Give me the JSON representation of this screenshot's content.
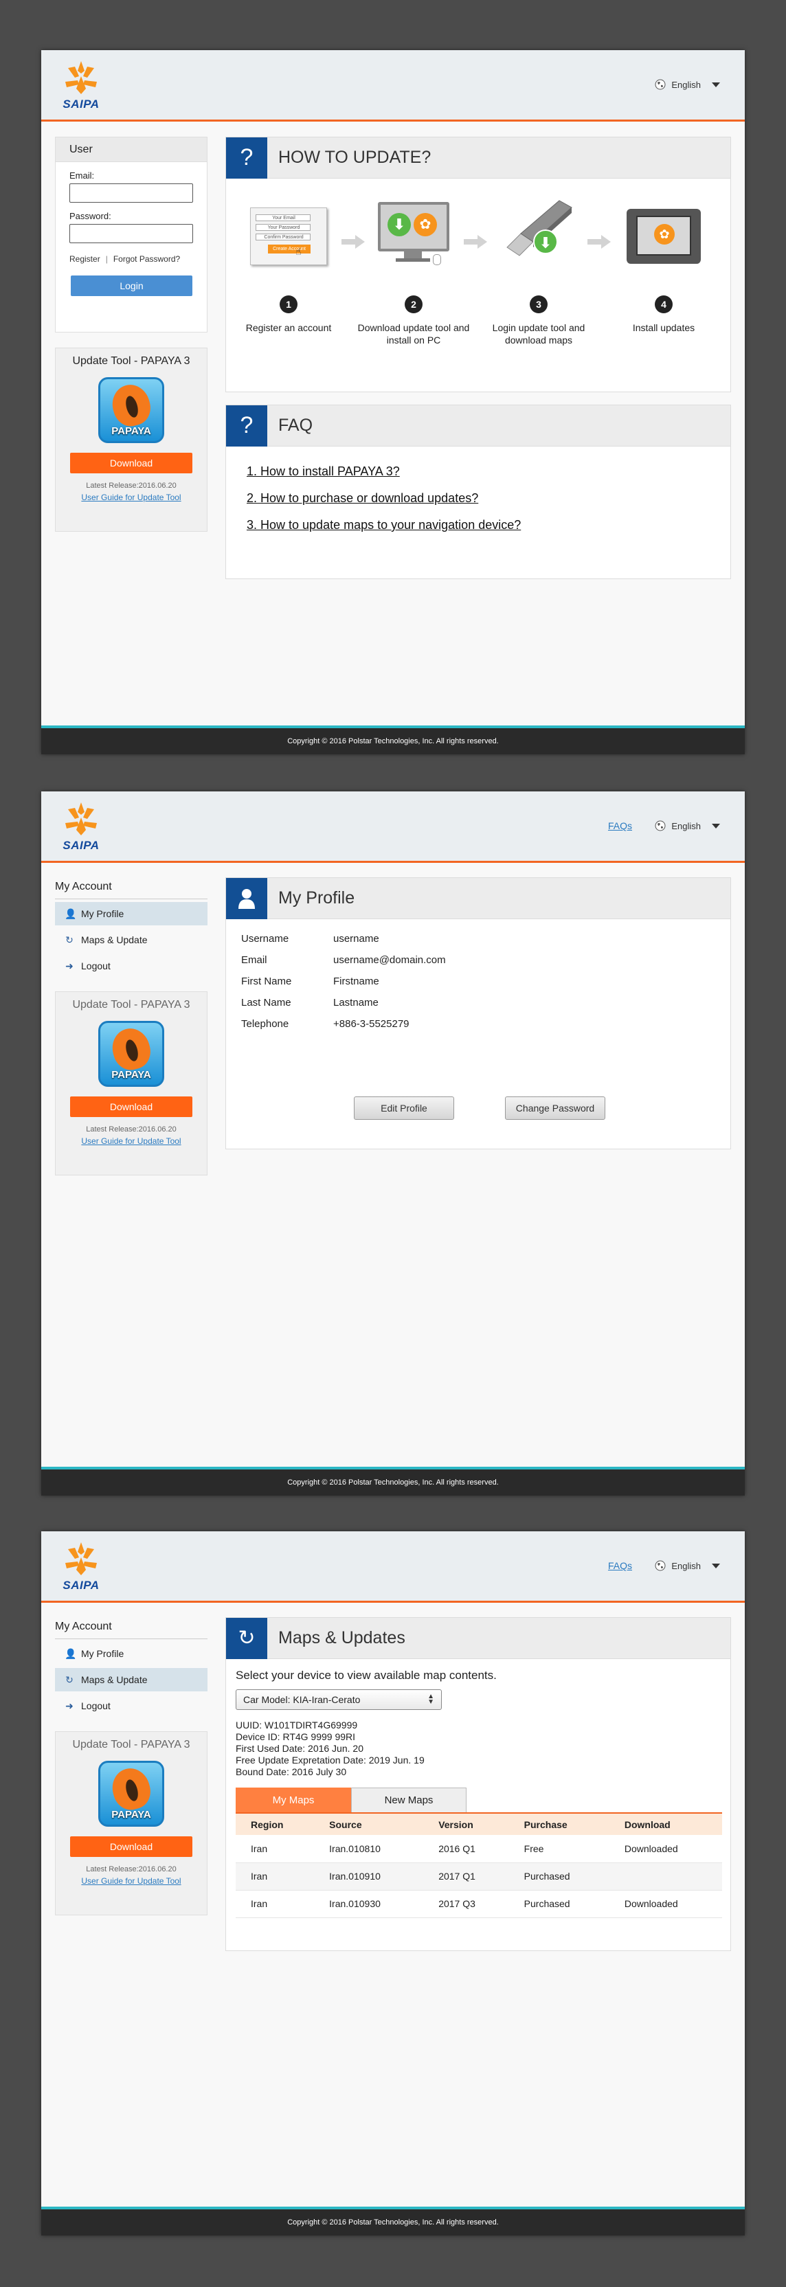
{
  "common": {
    "logo_text": "SAIPA",
    "language": "English",
    "faqs_link": "FAQs",
    "copyright": "Copyright © 2016 Polstar Technologies, Inc. All rights reserved.",
    "update_tool": {
      "title": "Update Tool - PAPAYA 3",
      "icon_label": "PAPAYA",
      "download": "Download",
      "latest_release": "Latest Release:2016.06.20",
      "guide": "User Guide for Update Tool"
    },
    "account_menu": {
      "title": "My Account",
      "items": [
        "My Profile",
        "Maps & Update",
        "Logout"
      ]
    }
  },
  "screen1": {
    "login": {
      "title": "User",
      "email_label": "Email:",
      "password_label": "Password:",
      "register": "Register",
      "forgot": "Forgot Password?",
      "login_button": "Login"
    },
    "how_to": {
      "icon": "?",
      "title": "HOW TO UPDATE?",
      "form_fields": [
        "Your Email",
        "Your Password",
        "Confirm Password"
      ],
      "form_button": "Create Account",
      "steps": [
        {
          "num": "1",
          "text": "Register an account"
        },
        {
          "num": "2",
          "text": "Download update tool and install on PC"
        },
        {
          "num": "3",
          "text": "Login update tool and download maps"
        },
        {
          "num": "4",
          "text": "Install updates"
        }
      ]
    },
    "faq": {
      "icon": "?",
      "title": "FAQ",
      "items": [
        "1.  How to install PAPAYA 3?",
        "2.  How to purchase or download updates?",
        "3.  How to update maps to your navigation device?"
      ]
    }
  },
  "screen2": {
    "title": "My Profile",
    "rows": [
      {
        "k": "Username",
        "v": "username"
      },
      {
        "k": "Email",
        "v": "username@domain.com"
      },
      {
        "k": "First Name",
        "v": "Firstname"
      },
      {
        "k": "Last Name",
        "v": "Lastname"
      },
      {
        "k": "Telephone",
        "v": "+886-3-5525279"
      }
    ],
    "edit_profile": "Edit Profile",
    "change_password": "Change Password"
  },
  "screen3": {
    "title": "Maps & Updates",
    "intro": "Select your device to view available map contents.",
    "car_model": "Car Model: KIA-Iran-Cerato",
    "device_info": [
      "UUID: W101TDIRT4G69999",
      "Device ID: RT4G 9999 99RI",
      "First Used Date: 2016 Jun. 20",
      "Free Update Expretation Date: 2019 Jun. 19",
      "Bound Date: 2016 July 30"
    ],
    "tabs": [
      "My Maps",
      "New Maps"
    ],
    "table": {
      "headers": [
        "Region",
        "Source",
        "Version",
        "Purchase",
        "Download"
      ],
      "rows": [
        [
          "Iran",
          "Iran.010810",
          "2016 Q1",
          "Free",
          "Downloaded"
        ],
        [
          "Iran",
          "Iran.010910",
          "2017 Q1",
          "Purchased",
          ""
        ],
        [
          "Iran",
          "Iran.010930",
          "2017 Q3",
          "Purchased",
          "Downloaded"
        ]
      ]
    }
  }
}
